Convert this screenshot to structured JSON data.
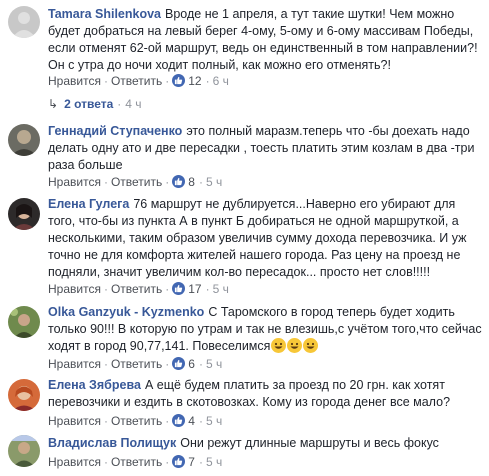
{
  "ui": {
    "like_label": "Нравится",
    "reply_label": "Ответить",
    "dot": "·"
  },
  "comments": [
    {
      "author": "Tamara Shilenkova",
      "text": "Вроде не 1 апреля, а тут такие шутки! Чем можно будет добраться на левый берег 4-ому, 5-ому и 6-ому массивам Победы, если отменят 62-ой маршрут, ведь он единственный в том направлении?! Он с утра до ночи ходит полный, как можно его отменять?!",
      "likes": "12",
      "time": "6 ч",
      "replies_label": "2 ответа",
      "replies_time": "4 ч",
      "avatar_color": "#c8c8c8"
    },
    {
      "author": "Геннадий Ступаченко",
      "text": "это полный маразм.теперь что -бы доехать надо делать одну ато и две пересадки , тоесть платить этим козлам в два -три раза больше",
      "likes": "8",
      "time": "5 ч",
      "avatar_color": "#6b6b63"
    },
    {
      "author": "Елена Гулега",
      "text": "76 маршрут не дублируется...Наверно его убирают для того, что-бы из пункта А в пункт Б добираться не одной маршруткой, а несколькими, таким образом увеличив сумму дохода перевозчика. И уж точно не для комфорта жителей нашего города. Раз цену на проезд не подняли, значит увеличим кол-во пересадок... просто нет слов!!!!!",
      "likes": "17",
      "time": "5 ч",
      "avatar_color": "#2d2a2a"
    },
    {
      "author": "Olka Ganzyuk - Kyzmenko",
      "text": "С Таромского в город теперь будет ходить только 90!!! В которую по утрам и так не влезишь,с учётом того,что сейчас ходят в город 90,77,141. Повеселимся",
      "likes": "6",
      "time": "5 ч",
      "avatar_color": "#6f8a4d"
    },
    {
      "author": "Елена Зябрева",
      "text": "А ещё будем платить за проезд по 20 грн. как хотят перевозчики и ездить в скотовозках. Кому из города денег все мало?",
      "likes": "4",
      "time": "5 ч",
      "avatar_color": "#d56a3a"
    },
    {
      "author": "Владислав Полищук",
      "text": "Они режут длинные маршруты и весь фокус",
      "likes": "7",
      "time": "5 ч",
      "avatar_color": "#8a9a6a"
    }
  ]
}
